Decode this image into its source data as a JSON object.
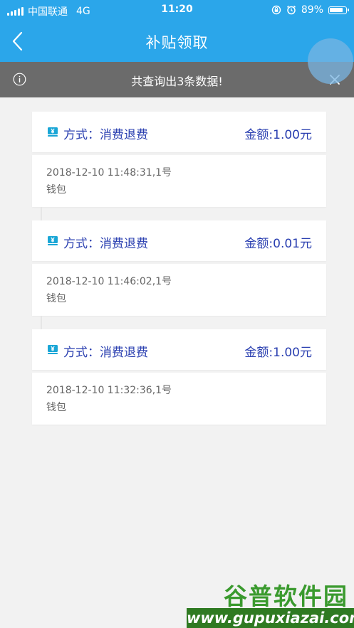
{
  "status_bar": {
    "carrier": "中国联通",
    "network": "4G",
    "time": "11:20",
    "battery_percent": "89%",
    "battery_level": 0.89
  },
  "nav": {
    "title": "补贴领取"
  },
  "notice": {
    "text": "共查询出3条数据!"
  },
  "records": [
    {
      "method": "方式：消费退费",
      "amount": "金额:1.00元",
      "time": "2018-12-10 11:48:31,1号",
      "account": "钱包"
    },
    {
      "method": "方式：消费退费",
      "amount": "金额:0.01元",
      "time": "2018-12-10 11:46:02,1号",
      "account": "钱包"
    },
    {
      "method": "方式：消费退费",
      "amount": "金额:1.00元",
      "time": "2018-12-10 11:32:36,1号",
      "account": "钱包"
    }
  ],
  "watermark": {
    "title": "谷普软件园",
    "url": "www.gupuxiazai.com"
  },
  "colors": {
    "header": "#2ba6ea",
    "notice_bg": "#6b6b6b",
    "accent_text": "#2a3fb0",
    "icon_teal": "#1aa6d6"
  },
  "icons": {
    "signal": "signal-icon",
    "lock_rotation": "rotation-lock-icon",
    "alarm": "alarm-icon",
    "battery": "battery-icon",
    "back": "back-arrow-icon",
    "info": "info-icon",
    "close": "close-icon",
    "yen": "yen-icon"
  }
}
